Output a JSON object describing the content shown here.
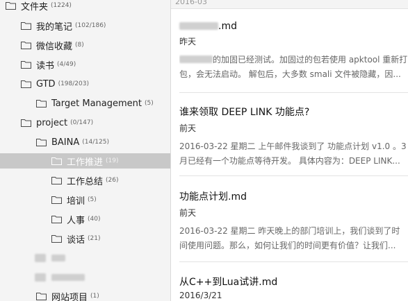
{
  "sidebar": {
    "root": {
      "label": "文件夹",
      "count": "(1224)"
    },
    "folders": [
      {
        "label": "我的笔记",
        "count": "(102/186)"
      },
      {
        "label": "微信收藏",
        "count": "(8)"
      },
      {
        "label": "读书",
        "count": "(4/49)"
      },
      {
        "label": "GTD",
        "count": "(198/203)"
      },
      {
        "label": "Target Management",
        "count": "(5)"
      },
      {
        "label": "project",
        "count": "(0/147)"
      },
      {
        "label": "BAINA",
        "count": "(14/125)"
      },
      {
        "label": "工作推进",
        "count": "(19)"
      },
      {
        "label": "工作总结",
        "count": "(26)"
      },
      {
        "label": "培训",
        "count": "(5)"
      },
      {
        "label": "人事",
        "count": "(40)"
      },
      {
        "label": "谈话",
        "count": "(21)"
      },
      {
        "label": "网站项目",
        "count": "(1)"
      }
    ]
  },
  "list": {
    "date_header": "2016-03",
    "notes": [
      {
        "title_suffix": ".md",
        "date": "昨天",
        "preview_line1": "的加固已经测试。加固过的包若使用 apktool 重新打",
        "preview_line2": "包，会无法启动。 解包后，大多数 smali 文件被隐藏，因..."
      },
      {
        "title": "谁来领取 DEEP LINK 功能点?",
        "date": "前天",
        "preview_line1": " 2016-03-22 星期二   上午邮件我谈到了 功能点计划 v1.0 。3",
        "preview_line2": "月已经有一个功能点等待开发。 具体内容为：DEEP LINK..."
      },
      {
        "title": "功能点计划.md",
        "date": "前天",
        "preview_line1": "2016-03-22 星期二    昨天晚上的部门培训上，我们谈到了时",
        "preview_line2": "间使用问题。那么，如何让我们的时间更有价值？让我们..."
      },
      {
        "title": "从C++到Lua试讲.md",
        "date": "2016/3/21"
      }
    ]
  },
  "colors": {
    "sidebar_bg": "#f4f4f4",
    "selected_bg": "#c8c8c8",
    "folder_stroke": "#4a4a4a"
  }
}
